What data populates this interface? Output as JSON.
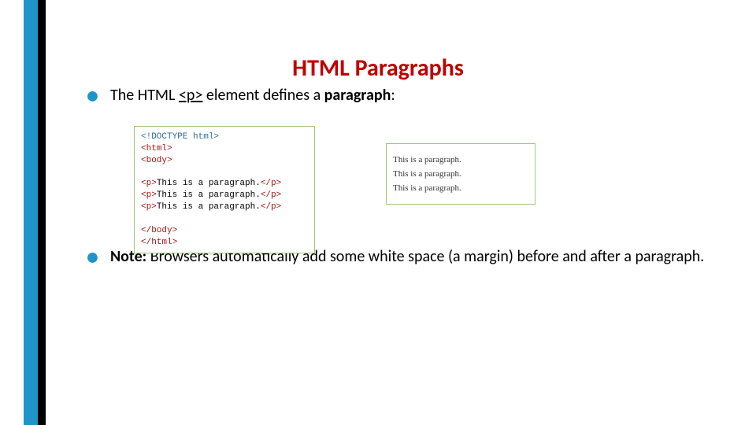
{
  "title": "HTML Paragraphs",
  "bullets": {
    "b1_pre": "The HTML ",
    "b1_mid": "<p>",
    "b1_post": " element defines a ",
    "b1_term": "paragraph",
    "b1_colon": ":",
    "b2_label": "Note:",
    "b2_text": " Browsers automatically add some white space (a margin) before and after a paragraph."
  },
  "code": {
    "doctype": "<!DOCTYPE html>",
    "html_open": "<html>",
    "body_open": "<body>",
    "p_open": "<p>",
    "p_text": "This is a paragraph.",
    "p_close": "</p>",
    "body_close": "</body>",
    "html_close": "</html>"
  },
  "output": {
    "line": "This is a paragraph."
  }
}
